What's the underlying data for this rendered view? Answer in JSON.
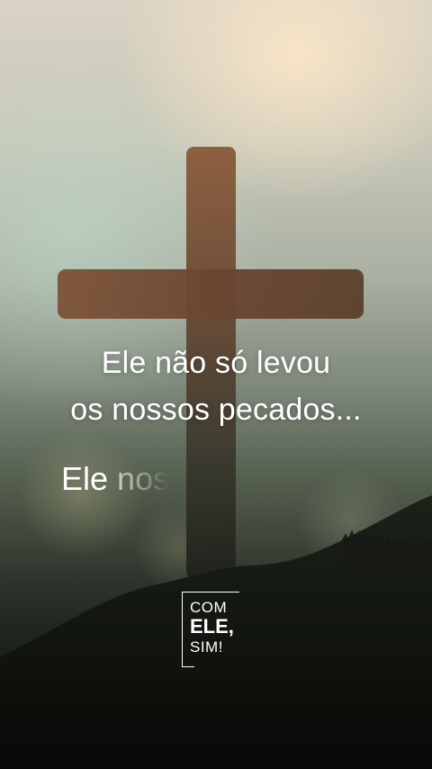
{
  "caption": {
    "line1": "Ele não só levou",
    "line2": "os nossos pecados...",
    "line3_visible": "Ele ",
    "line3_fading": "nos"
  },
  "logo": {
    "word1": "COM",
    "word2": "ELE,",
    "word3": "SIM!"
  },
  "colors": {
    "text": "#ffffff",
    "cross": "#6b4a34",
    "sky_light": "#e9dcc3",
    "ground": "#0b0c0a"
  },
  "image_subject": "cross-on-hill-at-sunrise"
}
